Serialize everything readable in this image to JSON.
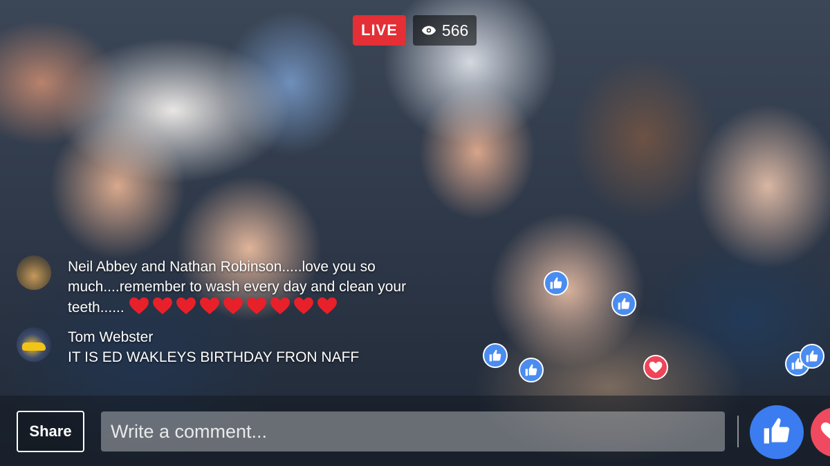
{
  "stream": {
    "live_label": "LIVE",
    "viewer_count": "566",
    "viewer_icon": "eye-icon"
  },
  "comments": [
    {
      "author": "Neil Abbey and Nathan Robinson.....love you so much....remember to wash every day and clean your teeth......",
      "text": "",
      "emoji": "heart",
      "emoji_count": 9
    },
    {
      "author": "Tom Webster",
      "text": "IT IS ED WAKLEYS BIRTHDAY FRON NAFF"
    }
  ],
  "floating_reactions": [
    "like",
    "like",
    "like",
    "like",
    "love",
    "like",
    "like"
  ],
  "composer": {
    "share_label": "Share",
    "comment_placeholder": "Write a comment...",
    "like_icon": "thumbs-up-icon",
    "love_icon": "heart-icon"
  },
  "colors": {
    "live_red": "#e32f35",
    "like_blue": "#3b7df0",
    "love_red": "#ef4a5f"
  }
}
